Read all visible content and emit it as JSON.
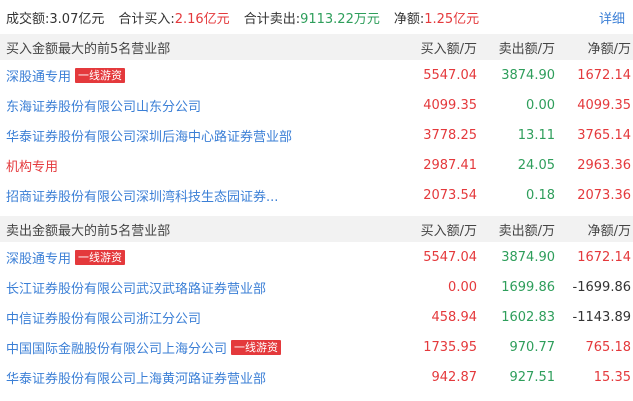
{
  "summary": {
    "turnover_label": "成交额:",
    "turnover_value": "3.07亿元",
    "buy_label": "合计买入:",
    "buy_value": "2.16亿元",
    "sell_label": "合计卖出:",
    "sell_value": "9113.22万元",
    "net_label": "净额:",
    "net_value": "1.25亿元",
    "detail_link": "详细"
  },
  "columns": {
    "buy_amount": "买入额/万",
    "sell_amount": "卖出额/万",
    "net_amount": "净额/万"
  },
  "buy_section": {
    "title": "买入金额最大的前5名营业部",
    "rows": [
      {
        "name": "深股通专用",
        "tag": "一线游资",
        "buy": "5547.04",
        "sell": "3874.90",
        "net": "1672.14"
      },
      {
        "name": "东海证券股份有限公司山东分公司",
        "tag": "",
        "buy": "4099.35",
        "sell": "0.00",
        "net": "4099.35"
      },
      {
        "name": "华泰证券股份有限公司深圳后海中心路证券营业部",
        "tag": "",
        "buy": "3778.25",
        "sell": "13.11",
        "net": "3765.14"
      },
      {
        "name": "机构专用",
        "tag": "",
        "buy": "2987.41",
        "sell": "24.05",
        "net": "2963.36"
      },
      {
        "name": "招商证券股份有限公司深圳湾科技生态园证券...",
        "tag": "",
        "buy": "2073.54",
        "sell": "0.18",
        "net": "2073.36"
      }
    ]
  },
  "sell_section": {
    "title": "卖出金额最大的前5名营业部",
    "rows": [
      {
        "name": "深股通专用",
        "tag": "一线游资",
        "buy": "5547.04",
        "sell": "3874.90",
        "net": "1672.14"
      },
      {
        "name": "长江证券股份有限公司武汉武珞路证券营业部",
        "tag": "",
        "buy": "0.00",
        "sell": "1699.86",
        "net": "-1699.86"
      },
      {
        "name": "中信证券股份有限公司浙江分公司",
        "tag": "",
        "buy": "458.94",
        "sell": "1602.83",
        "net": "-1143.89"
      },
      {
        "name": "中国国际金融股份有限公司上海分公司",
        "tag": "一线游资",
        "buy": "1735.95",
        "sell": "970.77",
        "net": "765.18"
      },
      {
        "name": "华泰证券股份有限公司上海黄河路证券营业部",
        "tag": "",
        "buy": "942.87",
        "sell": "927.51",
        "net": "15.35"
      }
    ]
  },
  "colors": {
    "red": "#e4393c",
    "green": "#2e9e5b",
    "link_blue": "#3b7fd6",
    "header_bg": "#f2f2f2"
  }
}
